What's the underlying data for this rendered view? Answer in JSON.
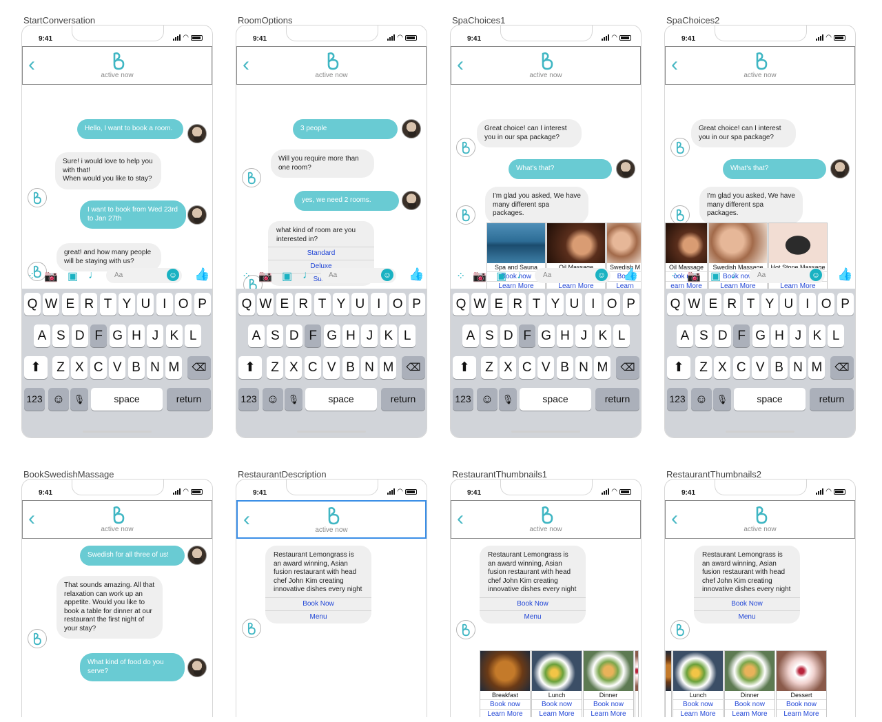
{
  "status": {
    "time": "9:41"
  },
  "header": {
    "back": "‹",
    "subtitle": "active now"
  },
  "composer": {
    "placeholder": "Aa"
  },
  "keyboard": {
    "row1": [
      "Q",
      "W",
      "E",
      "R",
      "T",
      "Y",
      "U",
      "I",
      "O",
      "P"
    ],
    "row2": [
      "A",
      "S",
      "D",
      "F",
      "G",
      "H",
      "J",
      "K",
      "L"
    ],
    "row3": [
      "Z",
      "X",
      "C",
      "V",
      "B",
      "N",
      "M"
    ],
    "num": "123",
    "space": "space",
    "return": "return"
  },
  "colors": {
    "accent": "#1ab2c2",
    "user_bubble": "#69cbd3",
    "bot_bubble": "#efefef",
    "link": "#2146d6"
  },
  "screens": [
    {
      "title": "StartConversation",
      "messages": [
        {
          "from": "me",
          "text": "Hello, I want to book a room."
        },
        {
          "from": "bot",
          "text": "Sure! i would love to help you with that!\nWhen would you like to stay?"
        },
        {
          "from": "me",
          "text": "I want to book from Wed 23rd to Jan 27th"
        },
        {
          "from": "bot",
          "text": "great! and how many people will be staying with us?"
        }
      ]
    },
    {
      "title": "RoomOptions",
      "messages": [
        {
          "from": "me",
          "text": "3 people"
        },
        {
          "from": "bot",
          "text": "Will you require more than one room?"
        },
        {
          "from": "me",
          "text": "yes, we need 2 rooms."
        }
      ],
      "options_card": {
        "question": "what kind of room are you interested in?",
        "options": [
          "Standard",
          "Deluxe",
          "Suite"
        ]
      }
    },
    {
      "title": "SpaChoices1",
      "messages": [
        {
          "from": "bot",
          "text": "Great choice! can I interest you in our spa package?"
        },
        {
          "from": "me",
          "text": "What's that?"
        },
        {
          "from": "bot",
          "text": "I'm glad you asked, We have many different spa packages."
        }
      ],
      "cards": [
        {
          "name": "Spa and Sauna",
          "book": "Book now",
          "learn": "Learn More",
          "image": "spa-pool"
        },
        {
          "name": "Oil Massage",
          "book": "Book now",
          "learn": "Learn More",
          "image": "oil-massage"
        },
        {
          "name": "Swedish M",
          "book": "Book",
          "learn": "Learn",
          "image": "swedish-massage"
        }
      ]
    },
    {
      "title": "SpaChoices2",
      "messages": [
        {
          "from": "bot",
          "text": "Great choice! can I interest you in our spa package?"
        },
        {
          "from": "me",
          "text": "What's that?"
        },
        {
          "from": "bot",
          "text": "I'm glad you asked, We have many different spa packages."
        }
      ],
      "cards": [
        {
          "name": "Oil Massage",
          "book": "ook now",
          "learn": "earn More",
          "image": "oil-massage"
        },
        {
          "name": "Swedish Massage",
          "book": "Book now",
          "learn": "Learn More",
          "image": "swedish-massage"
        },
        {
          "name": "Hot Stone Massage",
          "book": "Book now",
          "learn": "Learn More",
          "image": "hot-stone"
        }
      ]
    },
    {
      "title": "BookSwedishMassage",
      "messages": [
        {
          "from": "me",
          "text": "Swedish for all three of us!"
        },
        {
          "from": "bot",
          "text": "That sounds amazing. All that relaxation can work up an appetite. Would you like to book a table for dinner at our restaurant the first night of your stay?"
        },
        {
          "from": "me",
          "text": "What kind of food do you serve?"
        }
      ]
    },
    {
      "title": "RestaurantDescription",
      "restaurant_card": {
        "text": "Restaurant Lemongrass is an award winning, Asian fusion restaurant with head chef John Kim creating innovative dishes every night",
        "options": [
          "Book Now",
          "Menu"
        ]
      }
    },
    {
      "title": "RestaurantThumbnails1",
      "restaurant_card": {
        "text": "Restaurant Lemongrass is an award winning, Asian fusion restaurant with head chef John Kim creating innovative dishes every night",
        "options": [
          "Book Now",
          "Menu"
        ]
      },
      "cards": [
        {
          "name": "Breakfast",
          "book": "Book now",
          "learn": "Learn More",
          "image": "breakfast"
        },
        {
          "name": "Lunch",
          "book": "Book now",
          "learn": "Learn More",
          "image": "lunch"
        },
        {
          "name": "Dinner",
          "book": "Book now",
          "learn": "Learn More",
          "image": "dinner"
        }
      ]
    },
    {
      "title": "RestaurantThumbnails2",
      "restaurant_card": {
        "text": "Restaurant Lemongrass is an award winning, Asian fusion restaurant with head chef John Kim creating innovative dishes every night",
        "options": [
          "Book Now",
          "Menu"
        ]
      },
      "cards": [
        {
          "name": "Lunch",
          "book": "Book now",
          "learn": "Learn More",
          "image": "lunch"
        },
        {
          "name": "Dinner",
          "book": "Book now",
          "learn": "Learn More",
          "image": "dinner"
        },
        {
          "name": "Dessert",
          "book": "Book now",
          "learn": "Learn More",
          "image": "dessert"
        }
      ]
    }
  ]
}
